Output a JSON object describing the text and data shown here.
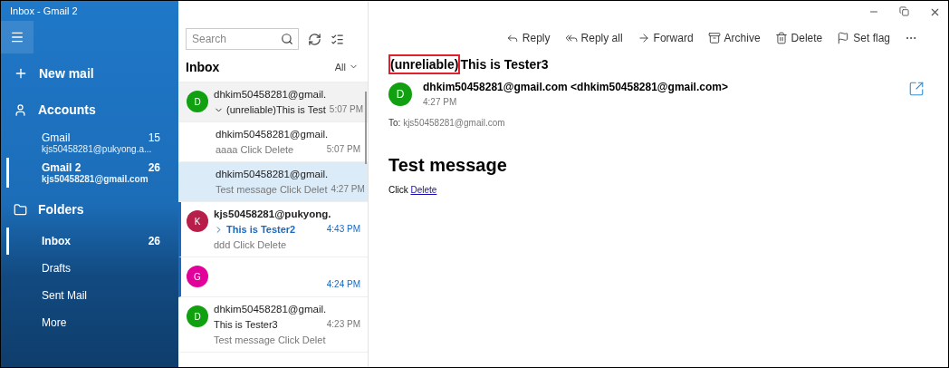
{
  "window": {
    "title": "Inbox - Gmail 2"
  },
  "sidebar": {
    "new_mail": "New mail",
    "accounts_header": "Accounts",
    "accounts": [
      {
        "name": "Gmail",
        "count": "15",
        "email": "kjs50458281@pukyong.a...",
        "selected": false
      },
      {
        "name": "Gmail 2",
        "count": "26",
        "email": "kjs50458281@gmail.com",
        "selected": true
      }
    ],
    "folders_header": "Folders",
    "folders": [
      {
        "name": "Inbox",
        "count": "26",
        "selected": true
      },
      {
        "name": "Drafts",
        "selected": false
      },
      {
        "name": "Sent Mail",
        "selected": false
      },
      {
        "name": "More",
        "selected": false
      }
    ]
  },
  "message_list": {
    "search": {
      "placeholder": "Search"
    },
    "title": "Inbox",
    "filter": "All",
    "items": [
      {
        "avatar": "D",
        "color": "#10a010",
        "sender": "dhkim50458281@gmail.",
        "subject": "(unreliable)This is Test",
        "time": "5:07 PM",
        "unread": false,
        "selected": false,
        "expanded": true,
        "children": [
          {
            "sender": "dhkim50458281@gmail.",
            "preview": "aaaa Click Delete",
            "time": "5:07 PM",
            "unread": false,
            "selected": false
          },
          {
            "sender": "dhkim50458281@gmail.",
            "preview": "Test message Click Delet",
            "time": "4:27 PM",
            "unread": false,
            "selected": true
          }
        ]
      },
      {
        "avatar": "K",
        "color": "#b81e4a",
        "sender": "kjs50458281@pukyong.",
        "subject": "This is Tester2",
        "preview": "ddd Click Delete",
        "time": "4:43 PM",
        "unread": true,
        "selected": false,
        "expanded": false
      },
      {
        "avatar": "G",
        "color": "#e3009a",
        "time": "4:24 PM",
        "unread": true,
        "selected": false
      },
      {
        "avatar": "D",
        "color": "#10a010",
        "sender": "dhkim50458281@gmail.",
        "subject": "This is Tester3",
        "preview": "Test message Click Delet",
        "time": "4:23 PM",
        "unread": false,
        "selected": false
      }
    ]
  },
  "toolbar": [
    {
      "kind": "reply",
      "label": "Reply"
    },
    {
      "kind": "reply_all",
      "label": "Reply all"
    },
    {
      "kind": "forward",
      "label": "Forward"
    },
    {
      "kind": "archive",
      "label": "Archive"
    },
    {
      "kind": "delete",
      "label": "Delete"
    },
    {
      "kind": "flag",
      "label": "Set flag"
    },
    {
      "kind": "more"
    }
  ],
  "reading_pane": {
    "subject": [
      {
        "text": "(unreliable)",
        "boxed": true
      },
      {
        "text": "This is Tester3",
        "boxed": false
      }
    ],
    "avatar": "D",
    "color": "#10a010",
    "from": "dhkim50458281@gmail.com <dhkim50458281@gmail.com>",
    "time": "4:27 PM",
    "to_label": "To:",
    "to": "kjs50458281@gmail.com",
    "heading": "Test message",
    "body_text": "Click",
    "body_link": "Delete"
  }
}
